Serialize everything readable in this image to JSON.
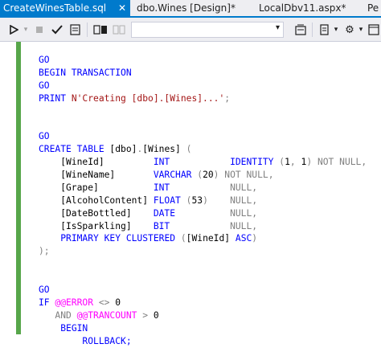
{
  "tabs": [
    {
      "label": "CreateWinesTable.sql",
      "active": true
    },
    {
      "label": "dbo.Wines [Design]*",
      "active": false
    },
    {
      "label": "LocalDbv11.aspx*",
      "active": false
    }
  ],
  "overflow_tab_label": "Pe",
  "icons": {
    "pin": "pin-icon",
    "close": "close-icon",
    "execute": "execute-icon",
    "stop": "stop-icon",
    "parse": "check-icon",
    "results": "results-icon"
  },
  "colors": {
    "accent": "#007acc",
    "keyword": "#0000ff",
    "string": "#a31515",
    "system_function": "#ff00ff",
    "operator": "#808080",
    "change_bar": "#57a64a"
  },
  "code": {
    "lines": [
      [
        {
          "t": "GO",
          "c": "kw"
        }
      ],
      [
        {
          "t": "BEGIN TRANSACTION",
          "c": "kw"
        }
      ],
      [
        {
          "t": "GO",
          "c": "kw"
        }
      ],
      [
        {
          "t": "PRINT ",
          "c": "kw"
        },
        {
          "t": "N'Creating [dbo].[Wines]...'",
          "c": "str"
        },
        {
          "t": ";",
          "c": "gray"
        }
      ],
      [],
      [],
      [
        {
          "t": "GO",
          "c": "kw"
        }
      ],
      [
        {
          "t": "CREATE TABLE ",
          "c": "kw"
        },
        {
          "t": "[dbo]",
          "c": "txt"
        },
        {
          "t": ".",
          "c": "gray"
        },
        {
          "t": "[Wines] ",
          "c": "txt"
        },
        {
          "t": "(",
          "c": "gray"
        }
      ],
      [
        {
          "t": "    [WineId]         ",
          "c": "txt"
        },
        {
          "t": "INT",
          "c": "kw"
        },
        {
          "t": "           ",
          "c": "txt"
        },
        {
          "t": "IDENTITY ",
          "c": "kw"
        },
        {
          "t": "(",
          "c": "gray"
        },
        {
          "t": "1",
          "c": "txt"
        },
        {
          "t": ", ",
          "c": "gray"
        },
        {
          "t": "1",
          "c": "txt"
        },
        {
          "t": ") ",
          "c": "gray"
        },
        {
          "t": "NOT NULL",
          "c": "gray"
        },
        {
          "t": ",",
          "c": "gray"
        }
      ],
      [
        {
          "t": "    [WineName]       ",
          "c": "txt"
        },
        {
          "t": "VARCHAR ",
          "c": "kw"
        },
        {
          "t": "(",
          "c": "gray"
        },
        {
          "t": "20",
          "c": "txt"
        },
        {
          "t": ") ",
          "c": "gray"
        },
        {
          "t": "NOT NULL",
          "c": "gray"
        },
        {
          "t": ",",
          "c": "gray"
        }
      ],
      [
        {
          "t": "    [Grape]          ",
          "c": "txt"
        },
        {
          "t": "INT",
          "c": "kw"
        },
        {
          "t": "           ",
          "c": "txt"
        },
        {
          "t": "NULL",
          "c": "gray"
        },
        {
          "t": ",",
          "c": "gray"
        }
      ],
      [
        {
          "t": "    [AlcoholContent] ",
          "c": "txt"
        },
        {
          "t": "FLOAT ",
          "c": "kw"
        },
        {
          "t": "(",
          "c": "gray"
        },
        {
          "t": "53",
          "c": "txt"
        },
        {
          "t": ")",
          "c": "gray"
        },
        {
          "t": "    ",
          "c": "txt"
        },
        {
          "t": "NULL",
          "c": "gray"
        },
        {
          "t": ",",
          "c": "gray"
        }
      ],
      [
        {
          "t": "    [DateBottled]    ",
          "c": "txt"
        },
        {
          "t": "DATE",
          "c": "kw"
        },
        {
          "t": "          ",
          "c": "txt"
        },
        {
          "t": "NULL",
          "c": "gray"
        },
        {
          "t": ",",
          "c": "gray"
        }
      ],
      [
        {
          "t": "    [IsSparkling]    ",
          "c": "txt"
        },
        {
          "t": "BIT",
          "c": "kw"
        },
        {
          "t": "           ",
          "c": "txt"
        },
        {
          "t": "NULL",
          "c": "gray"
        },
        {
          "t": ",",
          "c": "gray"
        }
      ],
      [
        {
          "t": "    ",
          "c": "txt"
        },
        {
          "t": "PRIMARY KEY CLUSTERED ",
          "c": "kw"
        },
        {
          "t": "(",
          "c": "gray"
        },
        {
          "t": "[WineId] ",
          "c": "txt"
        },
        {
          "t": "ASC",
          "c": "kw"
        },
        {
          "t": ")",
          "c": "gray"
        }
      ],
      [
        {
          "t": ");",
          "c": "gray"
        }
      ],
      [],
      [],
      [
        {
          "t": "GO",
          "c": "kw"
        }
      ],
      [
        {
          "t": "IF ",
          "c": "kw"
        },
        {
          "t": "@@ERROR",
          "c": "fn"
        },
        {
          "t": " <> ",
          "c": "gray"
        },
        {
          "t": "0",
          "c": "txt"
        }
      ],
      [
        {
          "t": "   ",
          "c": "txt"
        },
        {
          "t": "AND",
          "c": "gray"
        },
        {
          "t": " ",
          "c": "txt"
        },
        {
          "t": "@@TRANCOUNT",
          "c": "fn"
        },
        {
          "t": " > ",
          "c": "gray"
        },
        {
          "t": "0",
          "c": "txt"
        }
      ],
      [
        {
          "t": "    ",
          "c": "txt"
        },
        {
          "t": "BEGIN",
          "c": "kw"
        }
      ],
      [
        {
          "t": "        ",
          "c": "txt"
        },
        {
          "t": "ROLLBACK;",
          "c": "kw"
        }
      ]
    ]
  }
}
